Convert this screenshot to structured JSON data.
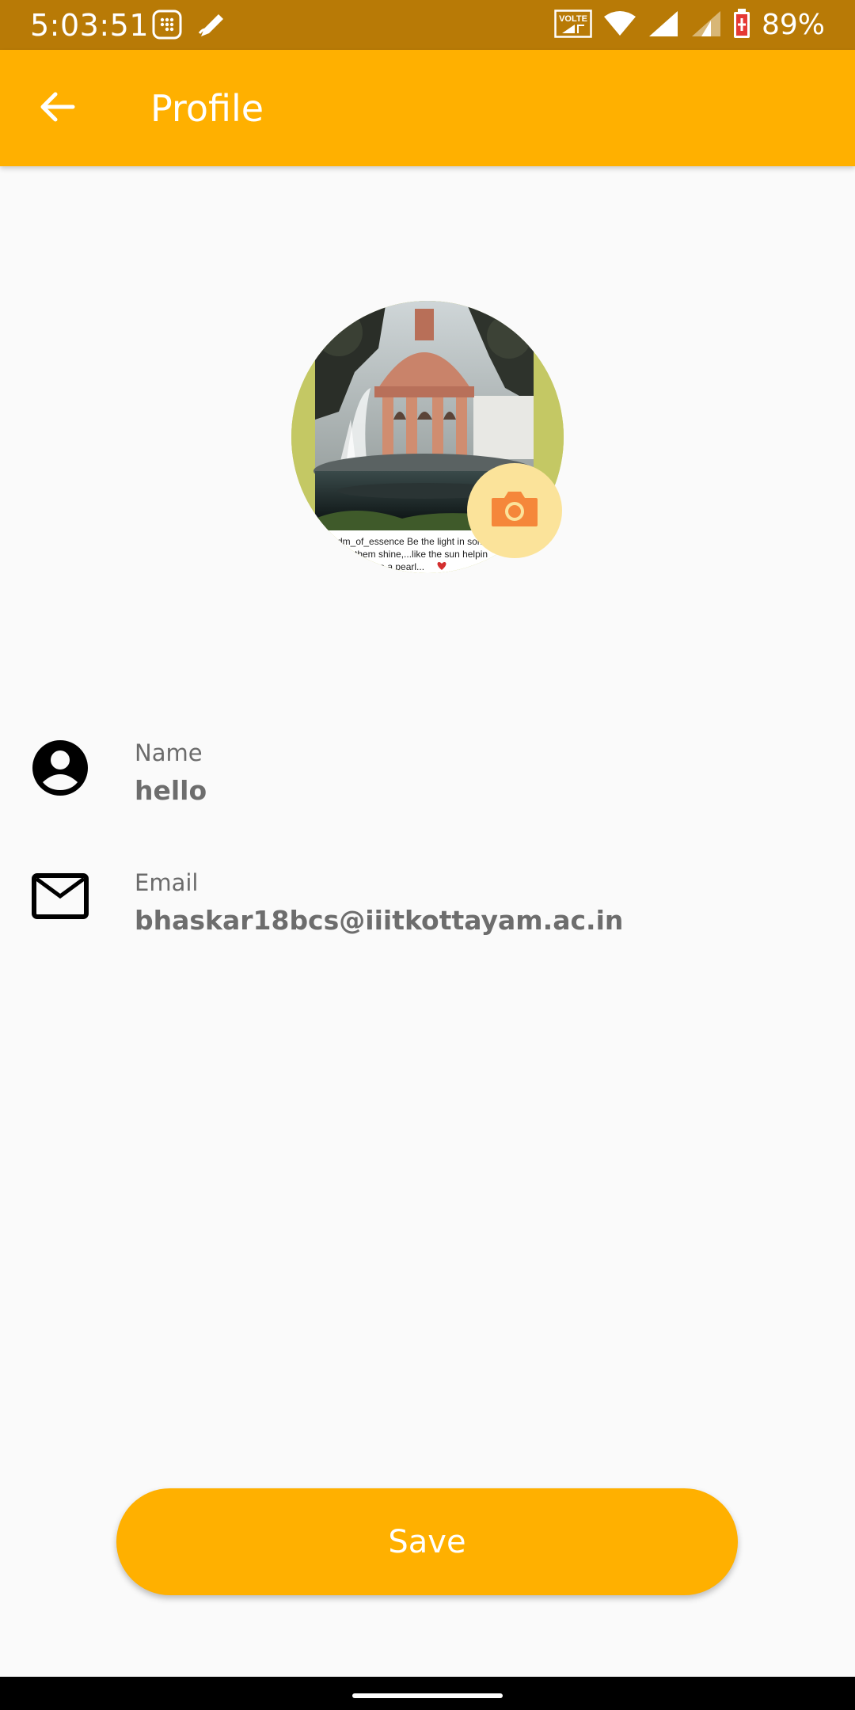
{
  "status_bar": {
    "time": "5:03:51",
    "battery": "89%",
    "network_badge": "VOLTE",
    "icons": [
      "keypad-icon",
      "pen-icon",
      "volte-icon",
      "wifi-icon",
      "signal-icon",
      "signal-icon",
      "battery-icon"
    ],
    "color": "#b87a06"
  },
  "app_bar": {
    "title": "Profile",
    "back_icon": "arrow-back-icon",
    "color": "#ffb000"
  },
  "avatar": {
    "caption_line1": "dm_of_essence Be the light in som",
    "caption_line2": "them shine,...like the sun helpin",
    "caption_line3": "like a pearl...",
    "camera_icon": "camera-icon"
  },
  "fields": {
    "name": {
      "label": "Name",
      "value": "hello",
      "icon": "account-circle-icon"
    },
    "email": {
      "label": "Email",
      "value": "bhaskar18bcs@iiitkottayam.ac.in",
      "icon": "mail-icon"
    }
  },
  "actions": {
    "save_label": "Save"
  },
  "colors": {
    "accent": "#ffb000",
    "camera_icon": "#f5873a",
    "camera_bg": "#fbe39a"
  }
}
